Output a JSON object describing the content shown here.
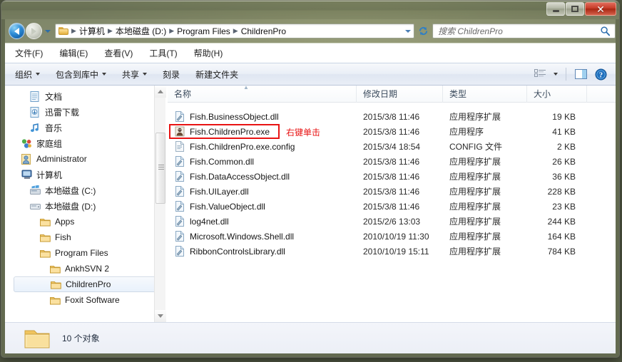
{
  "window": {
    "minimize_label": "Minimize",
    "maximize_label": "Maximize",
    "close_label": "✕"
  },
  "nav": {
    "back_label": "back-arrow",
    "forward_label": "forward-arrow",
    "recent_pages_label": "recent-pages"
  },
  "address": {
    "crumbs": [
      "计算机",
      "本地磁盘 (D:)",
      "Program Files",
      "ChildrenPro"
    ],
    "separator": "▶",
    "dropdown_label": "address-dropdown",
    "refresh_label": "refresh"
  },
  "search": {
    "placeholder": "搜索 ChildrenPro",
    "icon": "search-icon"
  },
  "menubar": {
    "items": [
      {
        "label": "文件(F)"
      },
      {
        "label": "编辑(E)"
      },
      {
        "label": "查看(V)"
      },
      {
        "label": "工具(T)"
      },
      {
        "label": "帮助(H)"
      }
    ]
  },
  "commandbar": {
    "items": [
      {
        "label": "组织",
        "caret": true
      },
      {
        "label": "包含到库中",
        "caret": true
      },
      {
        "label": "共享",
        "caret": true
      },
      {
        "label": "刻录",
        "caret": false
      },
      {
        "label": "新建文件夹",
        "caret": false
      }
    ],
    "view_icon": "view-options-icon",
    "view_caret": "chevron-down-icon",
    "preview_icon": "preview-pane-icon",
    "help_icon": "help-icon"
  },
  "sidebar": {
    "items": [
      {
        "label": "文档",
        "icon": "documents-icon",
        "indent": 34,
        "selected": false
      },
      {
        "label": "迅雷下载",
        "icon": "download-icon",
        "indent": 34,
        "selected": false
      },
      {
        "label": "音乐",
        "icon": "music-icon",
        "indent": 34,
        "selected": false
      },
      {
        "label": "家庭组",
        "icon": "homegroup-icon",
        "indent": 22,
        "selected": false
      },
      {
        "label": "Administrator",
        "icon": "user-icon",
        "indent": 22,
        "selected": false
      },
      {
        "label": "计算机",
        "icon": "computer-icon",
        "indent": 22,
        "selected": false
      },
      {
        "label": "本地磁盘 (C:)",
        "icon": "drive-system-icon",
        "indent": 34,
        "selected": false
      },
      {
        "label": "本地磁盘 (D:)",
        "icon": "drive-icon",
        "indent": 34,
        "selected": false
      },
      {
        "label": "Apps",
        "icon": "folder-icon",
        "indent": 48,
        "selected": false
      },
      {
        "label": "Fish",
        "icon": "folder-icon",
        "indent": 48,
        "selected": false
      },
      {
        "label": "Program Files",
        "icon": "folder-icon",
        "indent": 48,
        "selected": false
      },
      {
        "label": "AnkhSVN 2",
        "icon": "folder-icon",
        "indent": 62,
        "selected": false
      },
      {
        "label": "ChildrenPro",
        "icon": "folder-icon",
        "indent": 50,
        "selected": true
      },
      {
        "label": "Foxit Software",
        "icon": "folder-icon",
        "indent": 62,
        "selected": false
      }
    ]
  },
  "filelist": {
    "columns": [
      {
        "label": "名称"
      },
      {
        "label": "修改日期"
      },
      {
        "label": "类型"
      },
      {
        "label": "大小"
      }
    ],
    "sort_indicator": "▲",
    "rows": [
      {
        "name": "Fish.BusinessObject.dll",
        "icon": "dll-icon",
        "date": "2015/3/8 11:46",
        "type": "应用程序扩展",
        "size": "19 KB",
        "highlighted": false
      },
      {
        "name": "Fish.ChildrenPro.exe",
        "icon": "exe-icon",
        "date": "2015/3/8 11:46",
        "type": "应用程序",
        "size": "41 KB",
        "highlighted": true
      },
      {
        "name": "Fish.ChildrenPro.exe.config",
        "icon": "config-icon",
        "date": "2015/3/4 18:54",
        "type": "CONFIG 文件",
        "size": "2 KB",
        "highlighted": false
      },
      {
        "name": "Fish.Common.dll",
        "icon": "dll-icon",
        "date": "2015/3/8 11:46",
        "type": "应用程序扩展",
        "size": "26 KB",
        "highlighted": false
      },
      {
        "name": "Fish.DataAccessObject.dll",
        "icon": "dll-icon",
        "date": "2015/3/8 11:46",
        "type": "应用程序扩展",
        "size": "36 KB",
        "highlighted": false
      },
      {
        "name": "Fish.UILayer.dll",
        "icon": "dll-icon",
        "date": "2015/3/8 11:46",
        "type": "应用程序扩展",
        "size": "228 KB",
        "highlighted": false
      },
      {
        "name": "Fish.ValueObject.dll",
        "icon": "dll-icon",
        "date": "2015/3/8 11:46",
        "type": "应用程序扩展",
        "size": "23 KB",
        "highlighted": false
      },
      {
        "name": "log4net.dll",
        "icon": "dll-icon",
        "date": "2015/2/6 13:03",
        "type": "应用程序扩展",
        "size": "244 KB",
        "highlighted": false
      },
      {
        "name": "Microsoft.Windows.Shell.dll",
        "icon": "dll-icon",
        "date": "2010/10/19 11:30",
        "type": "应用程序扩展",
        "size": "164 KB",
        "highlighted": false
      },
      {
        "name": "RibbonControlsLibrary.dll",
        "icon": "dll-icon",
        "date": "2010/10/19 15:11",
        "type": "应用程序扩展",
        "size": "784 KB",
        "highlighted": false
      }
    ]
  },
  "annotation": {
    "text": "右键单击",
    "color": "#e81313"
  },
  "statusbar": {
    "folder_icon": "folder-large-icon",
    "text": "10 个对象"
  }
}
